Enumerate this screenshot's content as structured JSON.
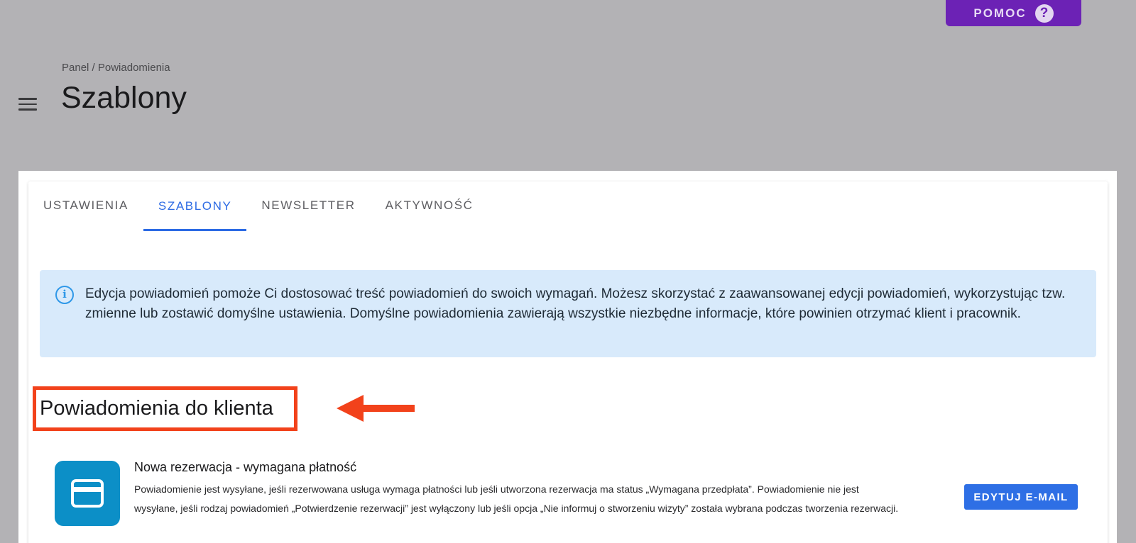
{
  "header": {
    "help_label": "POMOC",
    "help_icon_glyph": "?",
    "breadcrumb": "Panel / Powiadomienia",
    "title": "Szablony"
  },
  "tabs": [
    {
      "label": "USTAWIENIA",
      "active": false
    },
    {
      "label": "SZABLONY",
      "active": true
    },
    {
      "label": "NEWSLETTER",
      "active": false
    },
    {
      "label": "AKTYWNOŚĆ",
      "active": false
    }
  ],
  "info": {
    "icon_glyph": "i",
    "text": "Edycja powiadomień pomoże Ci dostosować treść powiadomień do swoich wymagań. Możesz skorzystać z zaawansowanej edycji powiadomień, wykorzystując tzw. zmienne lub zostawić domyślne ustawienia. Domyślne powiadomienia zawierają wszystkie niezbędne informacje, które powinien otrzymać klient i pracownik."
  },
  "section": {
    "title": "Powiadomienia do klienta"
  },
  "notification": {
    "icon": "credit-card-icon",
    "title": "Nowa rezerwacja - wymagana płatność",
    "description": "Powiadomienie jest wysyłane, jeśli rezerwowana usługa wymaga płatności lub jeśli utworzona rezerwacja ma status „Wymagana przedpłata”. Powiadomienie nie jest wysyłane, jeśli rodzaj powiadomień „Potwierdzenie rezerwacji” jest wyłączony lub jeśli opcja „Nie informuj o stworzeniu wizyty” została wybrana podczas tworzenia rezerwacji.",
    "edit_label": "EDYTUJ E-MAIL"
  },
  "colors": {
    "accent": "#2e6fe5",
    "help": "#6c22b5",
    "highlight": "#f2421b",
    "info_bg": "#d8eafb"
  }
}
